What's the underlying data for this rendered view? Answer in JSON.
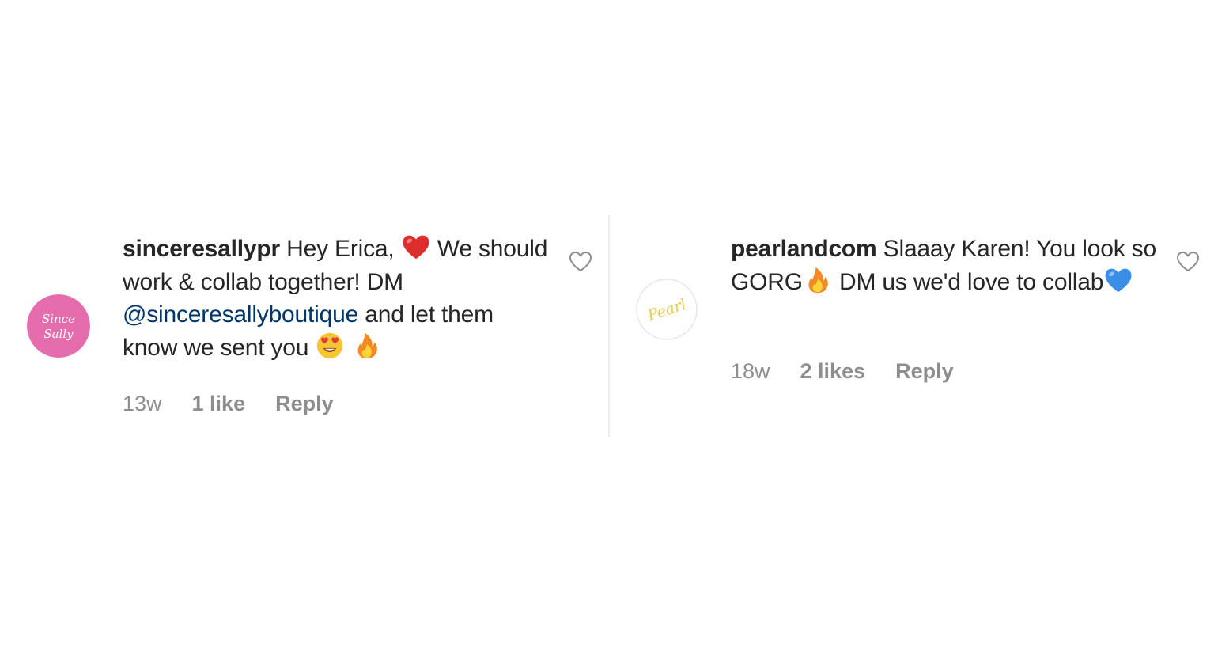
{
  "comments": [
    {
      "avatar": {
        "logo_text": [
          "Since",
          "Sally"
        ],
        "color": "#e56dad"
      },
      "username": "sinceresallypr",
      "text_parts": {
        "part1": "Hey Erica,",
        "emoji1": "red-heart",
        "part2": "We should work & collab together! DM",
        "mention": "@sinceresallyboutique",
        "part3": "and let them know we sent you",
        "emoji2": "heart-eyes-face",
        "emoji3": "fire"
      },
      "time": "13w",
      "likes": "1 like",
      "reply": "Reply",
      "like_icon": "heart-outline-icon"
    },
    {
      "avatar": {
        "logo_text": "Pearl",
        "color": "#e9c84a"
      },
      "username": "pearlandcom",
      "text_parts": {
        "part1": "Slaaay Karen! You look so GORG",
        "emoji1": "fire",
        "part2": "DM us we'd love to collab",
        "emoji2": "blue-heart"
      },
      "time": "18w",
      "likes": "2 likes",
      "reply": "Reply",
      "like_icon": "heart-outline-icon"
    }
  ],
  "colors": {
    "text": "#262626",
    "meta": "#8e8e8e",
    "mention": "#003569",
    "divider": "#ededed"
  }
}
